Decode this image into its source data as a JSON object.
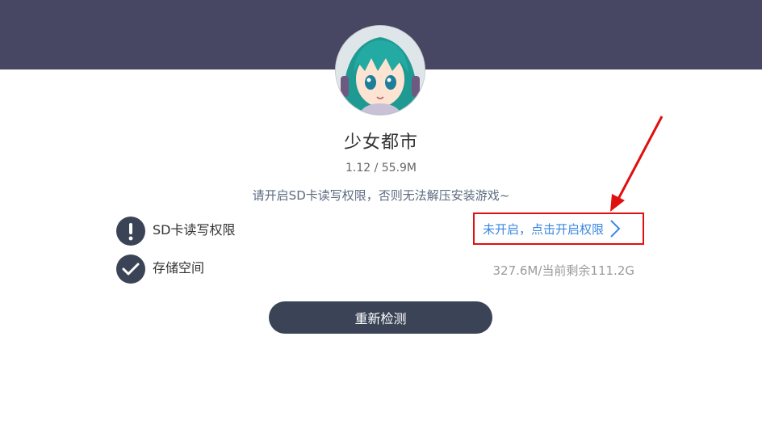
{
  "app": {
    "name": "少女都市",
    "meta": "1.12 / 55.9M",
    "hint": "请开启SD卡读写权限，否则无法解压安装游戏~"
  },
  "permissions": {
    "sd": {
      "label": "SD卡读写权限",
      "action": "未开启，点击开启权限",
      "icon": "exclamation-icon"
    },
    "storage": {
      "label": "存储空间",
      "info": "327.6M/当前剩余111.2G",
      "icon": "check-icon"
    }
  },
  "retest_button": "重新检测",
  "colors": {
    "header": "#474763",
    "dark": "#3b4457",
    "link": "#3a86e0",
    "highlight": "#e01010"
  }
}
